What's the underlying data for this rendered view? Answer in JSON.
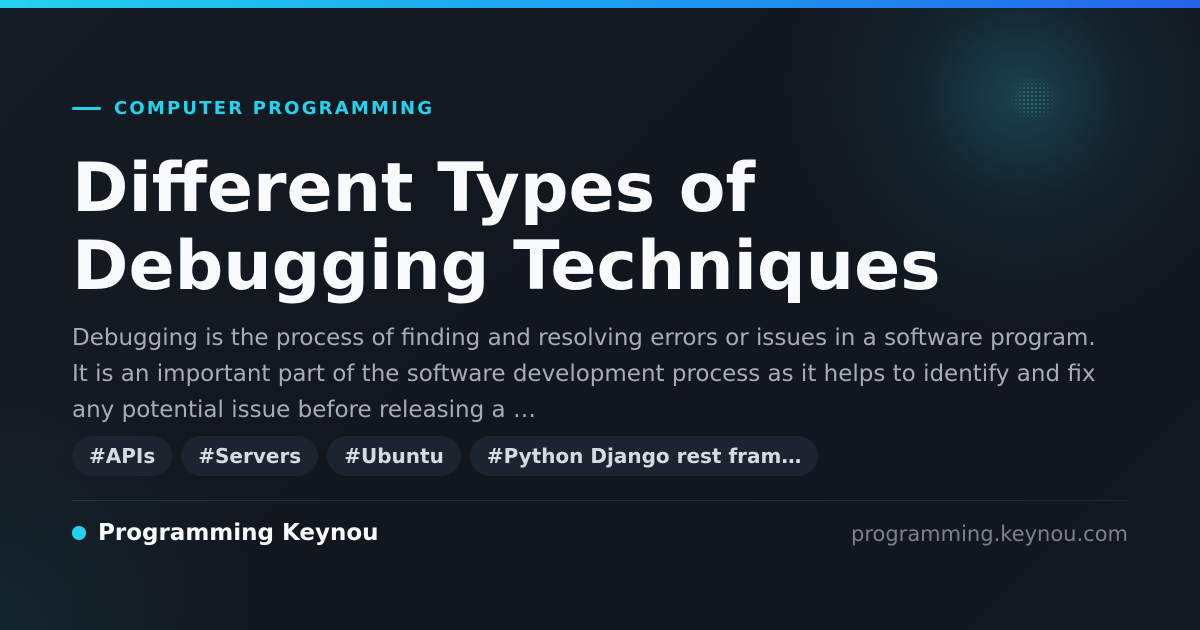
{
  "card": {
    "category": "COMPUTER PROGRAMMING",
    "title": "Different Types of Debugging Techniques",
    "description": "Debugging is the process of finding and resolving errors or issues in a software program. It is an important part of the software development process as it helps to identify and fix any potential issue before releasing a …",
    "tags": [
      "#APIs",
      "#Servers",
      "#Ubuntu",
      "#Python Django rest fram…"
    ],
    "brand_name": "Programming Keynou",
    "domain": "programming.keynou.com"
  },
  "colors": {
    "accent": "#22d3ee",
    "background": "#131821",
    "tag_background": "#1c2430"
  },
  "icons": {
    "brand_marker": "dot-icon",
    "category_marker": "dash-icon"
  }
}
